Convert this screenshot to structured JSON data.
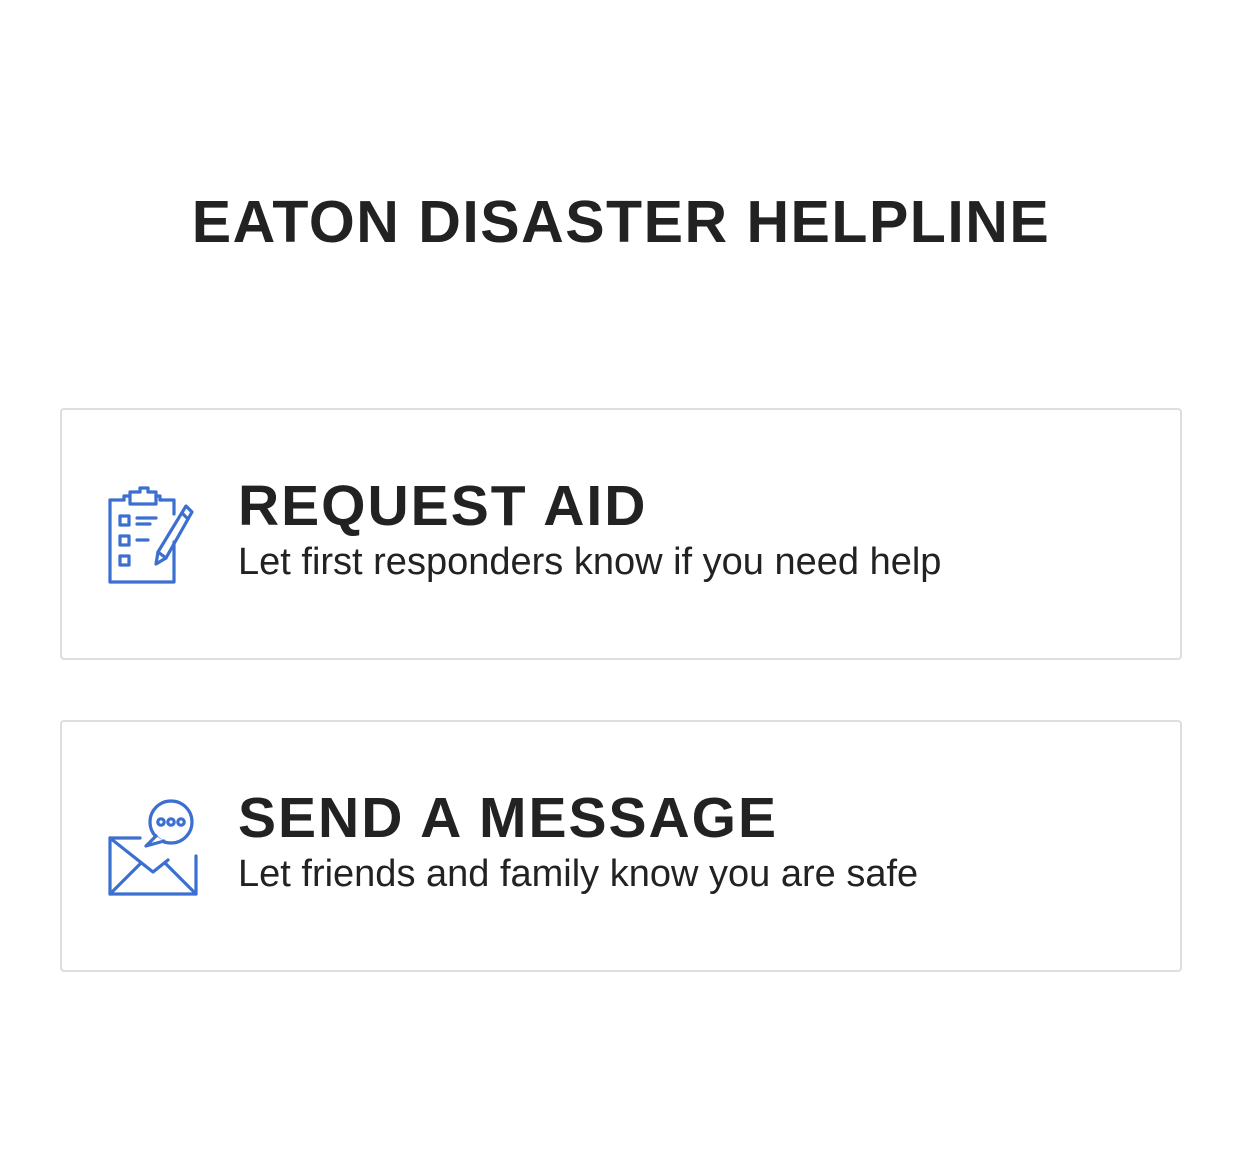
{
  "page": {
    "title": "EATON DISASTER HELPLINE"
  },
  "cards": [
    {
      "heading": "REQUEST AID",
      "subtext": "Let first responders know if you need help",
      "icon": "clipboard-checklist-icon"
    },
    {
      "heading": "SEND A MESSAGE",
      "subtext": "Let friends and family know you are safe",
      "icon": "envelope-chat-icon"
    }
  ],
  "colors": {
    "icon_accent": "#3b6fd0",
    "text": "#222222",
    "card_border": "#dedede"
  }
}
